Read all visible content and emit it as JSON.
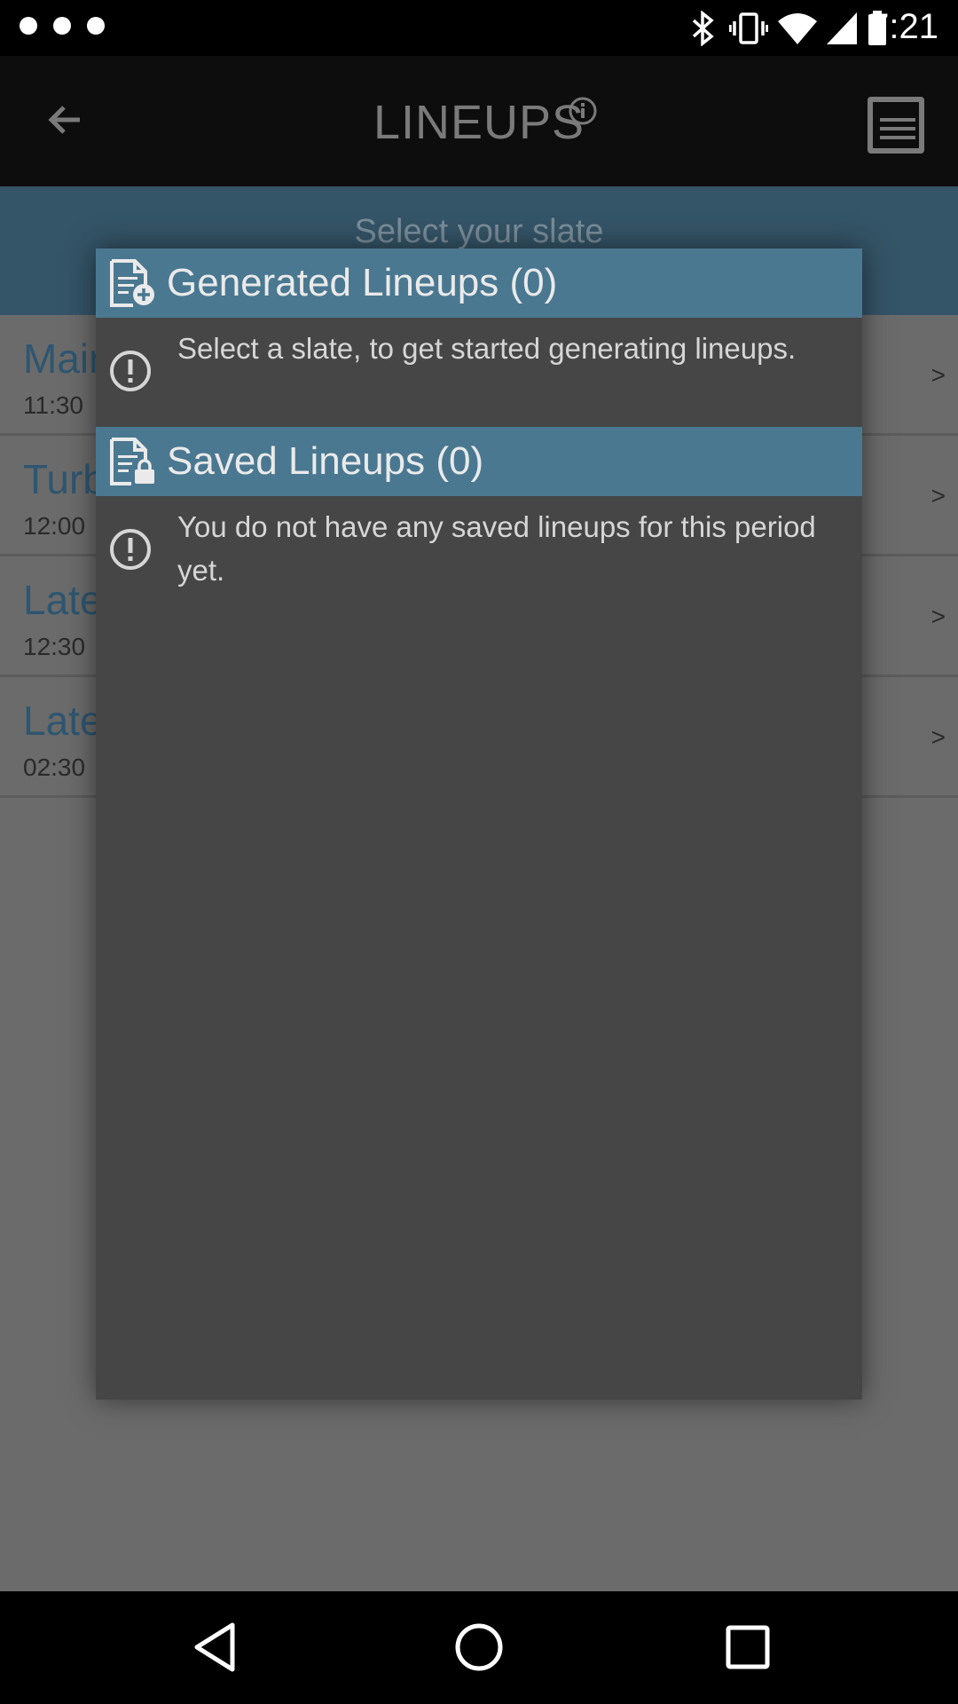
{
  "status_bar": {
    "time": "7:21",
    "icons": [
      "notification-dot",
      "notification-dot",
      "notification-dot",
      "bluetooth-icon",
      "vibrate-icon",
      "wifi-icon",
      "signal-icon",
      "battery-icon"
    ]
  },
  "app_bar": {
    "title": "LINEUPS",
    "back_icon": "arrow-back-icon",
    "info_icon": "info-icon",
    "action_icon": "list-document-icon"
  },
  "subheader": {
    "label": "Select your slate"
  },
  "slates": [
    {
      "name": "Main",
      "time": "11:30",
      "chevron": ">"
    },
    {
      "name": "Turb",
      "time": "12:00",
      "chevron": ">"
    },
    {
      "name": "Late",
      "time": "12:30",
      "chevron": ">"
    },
    {
      "name": "Late",
      "time": "02:30",
      "chevron": ">"
    }
  ],
  "dialog": {
    "generated": {
      "title": "Generated Lineups (0)",
      "icon": "document-add-icon",
      "message": "Select a slate, to get started generating lineups.",
      "message_icon": "alert-circle-icon"
    },
    "saved": {
      "title": "Saved Lineups (0)",
      "icon": "document-lock-icon",
      "message": "You do not have any saved lineups for this period yet.",
      "message_icon": "alert-circle-icon"
    }
  },
  "colors": {
    "section_header": "#4a7891",
    "dialog_bg": "#464646",
    "subheader_bg": "#345467",
    "slate_name": "#2e5670"
  },
  "nav_bar": {
    "buttons": [
      "back-triangle-icon",
      "home-circle-icon",
      "recents-square-icon"
    ]
  }
}
